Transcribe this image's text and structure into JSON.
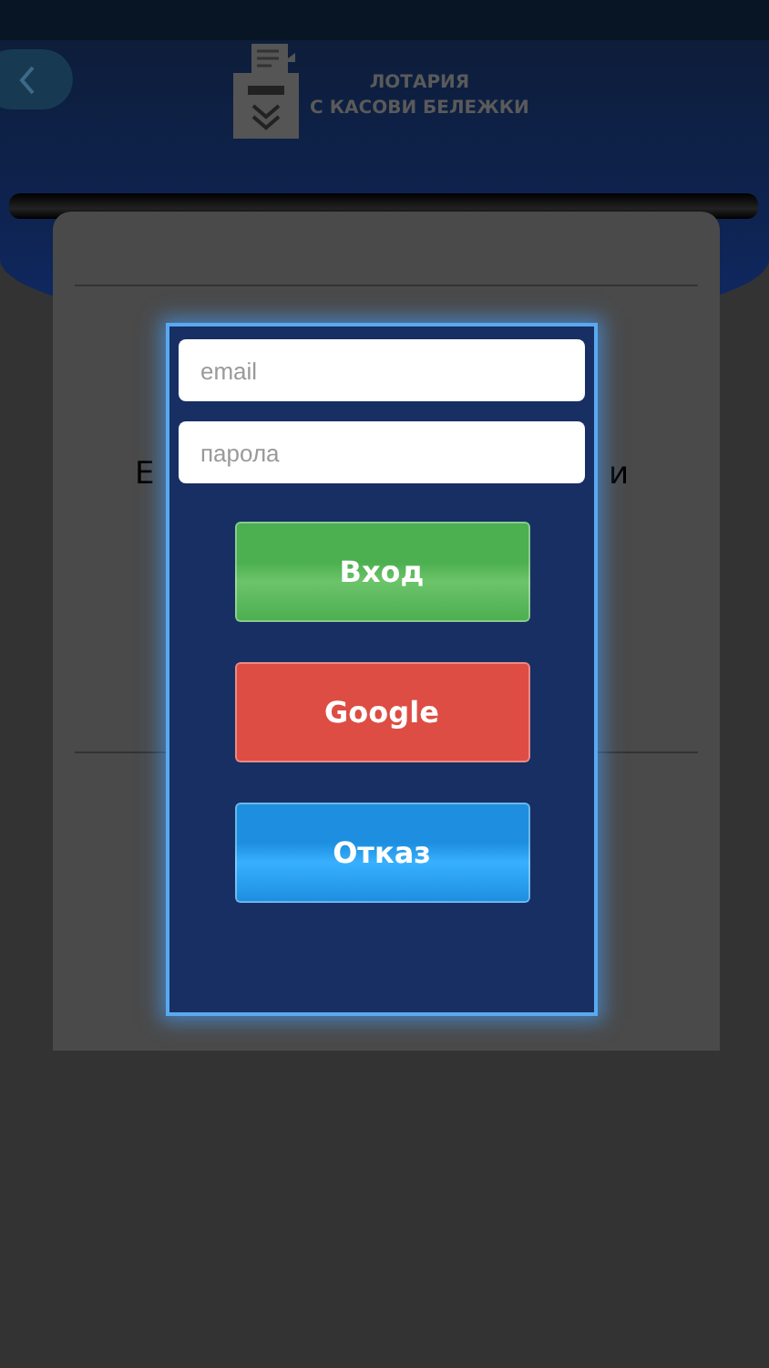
{
  "header": {
    "title_line_1": "ЛОТАРИЯ",
    "title_line_2": "С КАСОВИ БЕЛЕЖКИ"
  },
  "background_text": {
    "left_part": "Е",
    "right_part": "и"
  },
  "login_dialog": {
    "fields": [
      {
        "placeholder": "email"
      },
      {
        "placeholder": "парола"
      }
    ],
    "buttons": [
      {
        "label": "Вход",
        "kind": "login"
      },
      {
        "label": "Google",
        "kind": "google"
      },
      {
        "label": "Отказ",
        "kind": "cancel"
      }
    ]
  }
}
